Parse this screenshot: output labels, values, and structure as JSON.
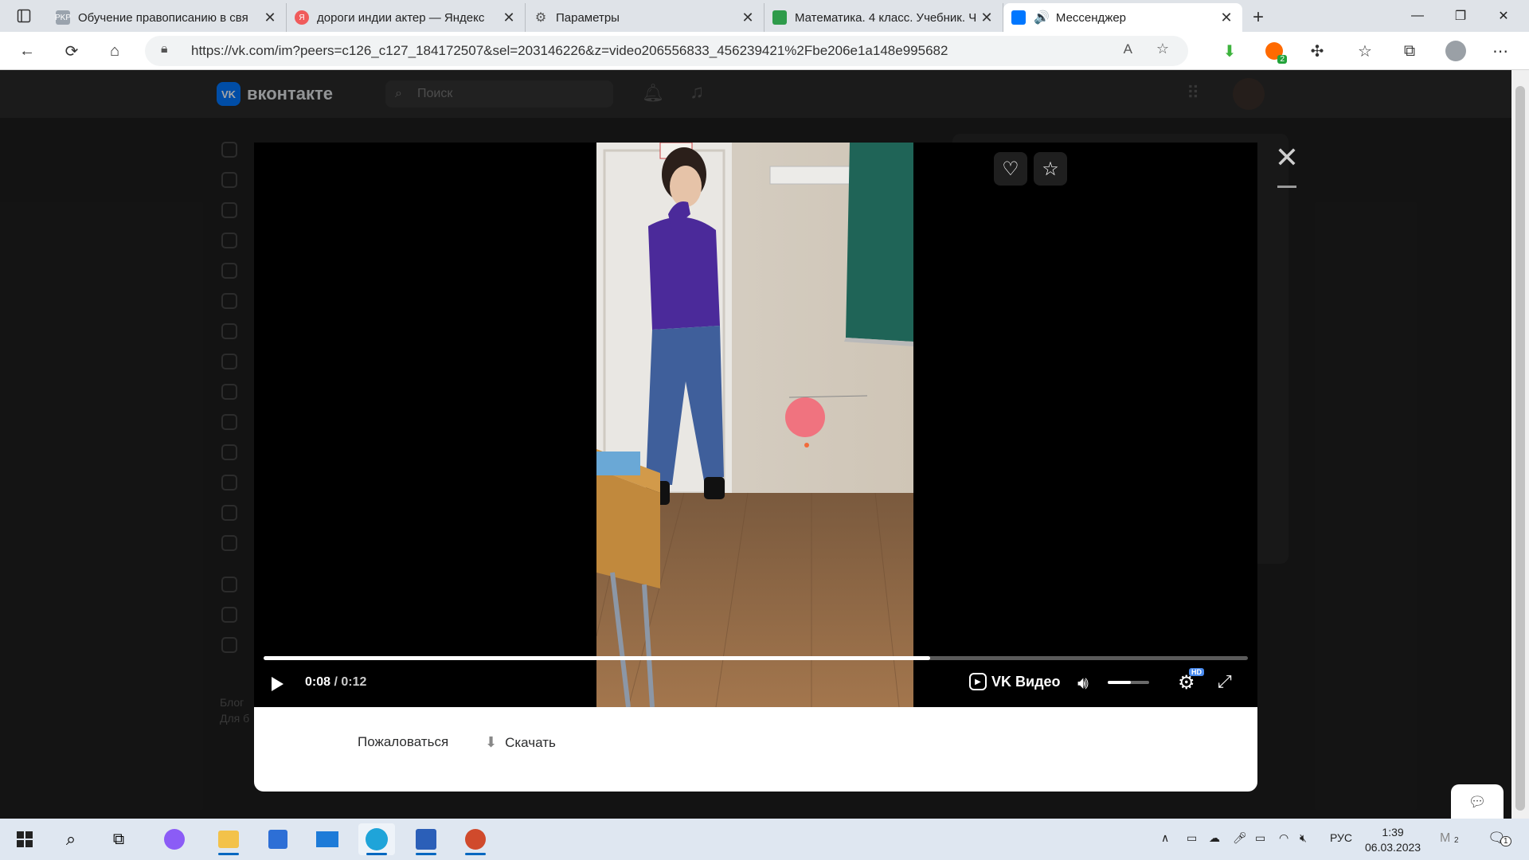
{
  "browser": {
    "tabs": [
      {
        "title": "Обучение правописанию в свя",
        "favicon": "PKP",
        "active": false
      },
      {
        "title": "дороги индии актер — Яндекс",
        "favicon": "Я",
        "active": false
      },
      {
        "title": "Параметры",
        "favicon": "gear",
        "active": false
      },
      {
        "title": "Математика. 4 класс. Учебник. Ч",
        "favicon": "book",
        "active": false
      },
      {
        "title": "Мессенджер",
        "favicon": "vk",
        "active": true
      }
    ],
    "url": "https://vk.com/im?peers=c126_c127_184172507&sel=203146226&z=video206556833_456239421%2Fbe206e1a148e995682",
    "colors": {
      "tabbar": "#dfe3e8",
      "accent": "#0067c0"
    }
  },
  "vk": {
    "logo_text": "вконтакте",
    "logo_mark": "VK",
    "search_placeholder": "Поиск",
    "footer_line1": "Блог",
    "footer_line2": "Для б"
  },
  "player": {
    "time_current": "0:08",
    "time_total": "0:12",
    "separator": "/",
    "progress": 0.677,
    "volume": 0.55,
    "brand": "VK Видео",
    "hd_badge": "HD"
  },
  "actions": {
    "report_label": "Пожаловаться",
    "download_label": "Скачать"
  },
  "taskbar": {
    "language": "РУС",
    "time": "1:39",
    "date": "06.03.2023",
    "notification_count": "1",
    "account_badge": "2",
    "ext_badge": "2"
  }
}
